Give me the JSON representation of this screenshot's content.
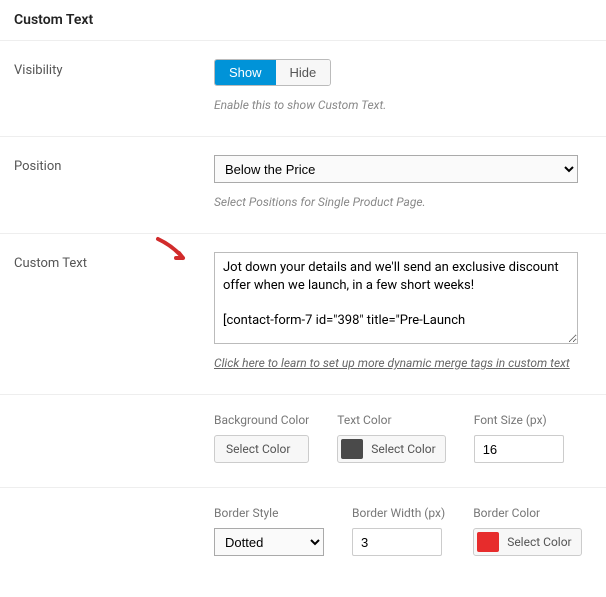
{
  "header": {
    "title": "Custom Text"
  },
  "visibility": {
    "label": "Visibility",
    "show": "Show",
    "hide": "Hide",
    "hint": "Enable this to show Custom Text."
  },
  "position": {
    "label": "Position",
    "value": "Below the Price",
    "hint": "Select Positions for Single Product Page."
  },
  "customText": {
    "label": "Custom Text",
    "value": "Jot down your details and we'll send an exclusive discount offer when we launch, in a few short weeks!\n\n[contact-form-7 id=\"398\" title=\"Pre-Launch",
    "link": "Click here to learn to set up more dynamic merge tags in custom text"
  },
  "styleRow1": {
    "bgColor": {
      "label": "Background Color",
      "btn": "Select Color"
    },
    "textColor": {
      "label": "Text Color",
      "btn": "Select Color",
      "color": "#4a4a4a"
    },
    "fontSize": {
      "label": "Font Size (px)",
      "value": "16"
    }
  },
  "styleRow2": {
    "borderStyle": {
      "label": "Border Style",
      "value": "Dotted"
    },
    "borderWidth": {
      "label": "Border Width (px)",
      "value": "3"
    },
    "borderColor": {
      "label": "Border Color",
      "btn": "Select Color",
      "color": "#e72c2c"
    }
  }
}
